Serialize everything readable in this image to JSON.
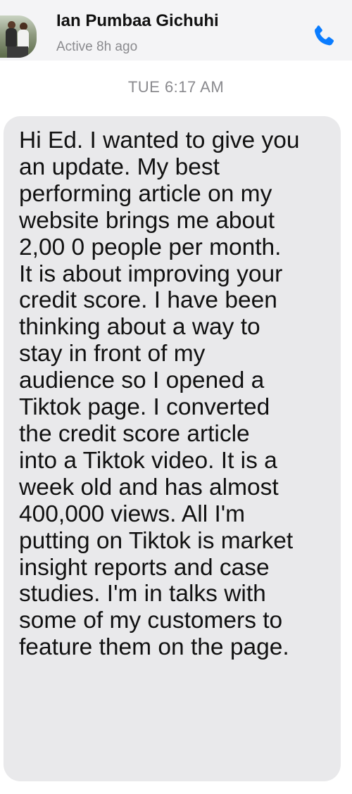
{
  "header": {
    "name": "Ian Pumbaa Gichuhi",
    "status": "Active 8h ago",
    "avatar_icon": "profile-photo",
    "call_icon": "phone-icon",
    "accent_color": "#0a7cff"
  },
  "conversation": {
    "timestamp": "TUE 6:17 AM",
    "messages": [
      {
        "direction": "incoming",
        "bubble_color": "#e9e9eb",
        "text": "Hi Ed. I wanted to give you\nan update. My best\nperforming article on my\nwebsite brings me about\n2,00 0 people per month.\nIt is about improving your\ncredit score. I have been\nthinking about a way to\nstay in front of my\naudience so I opened a\nTiktok page. I converted\nthe credit score article\ninto a Tiktok video. It is a\nweek old and has almost\n400,000 views. All I'm\nputting on Tiktok is market\ninsight reports and case\nstudies. I'm in talks with\nsome of my customers to\nfeature them on the page."
      }
    ]
  }
}
